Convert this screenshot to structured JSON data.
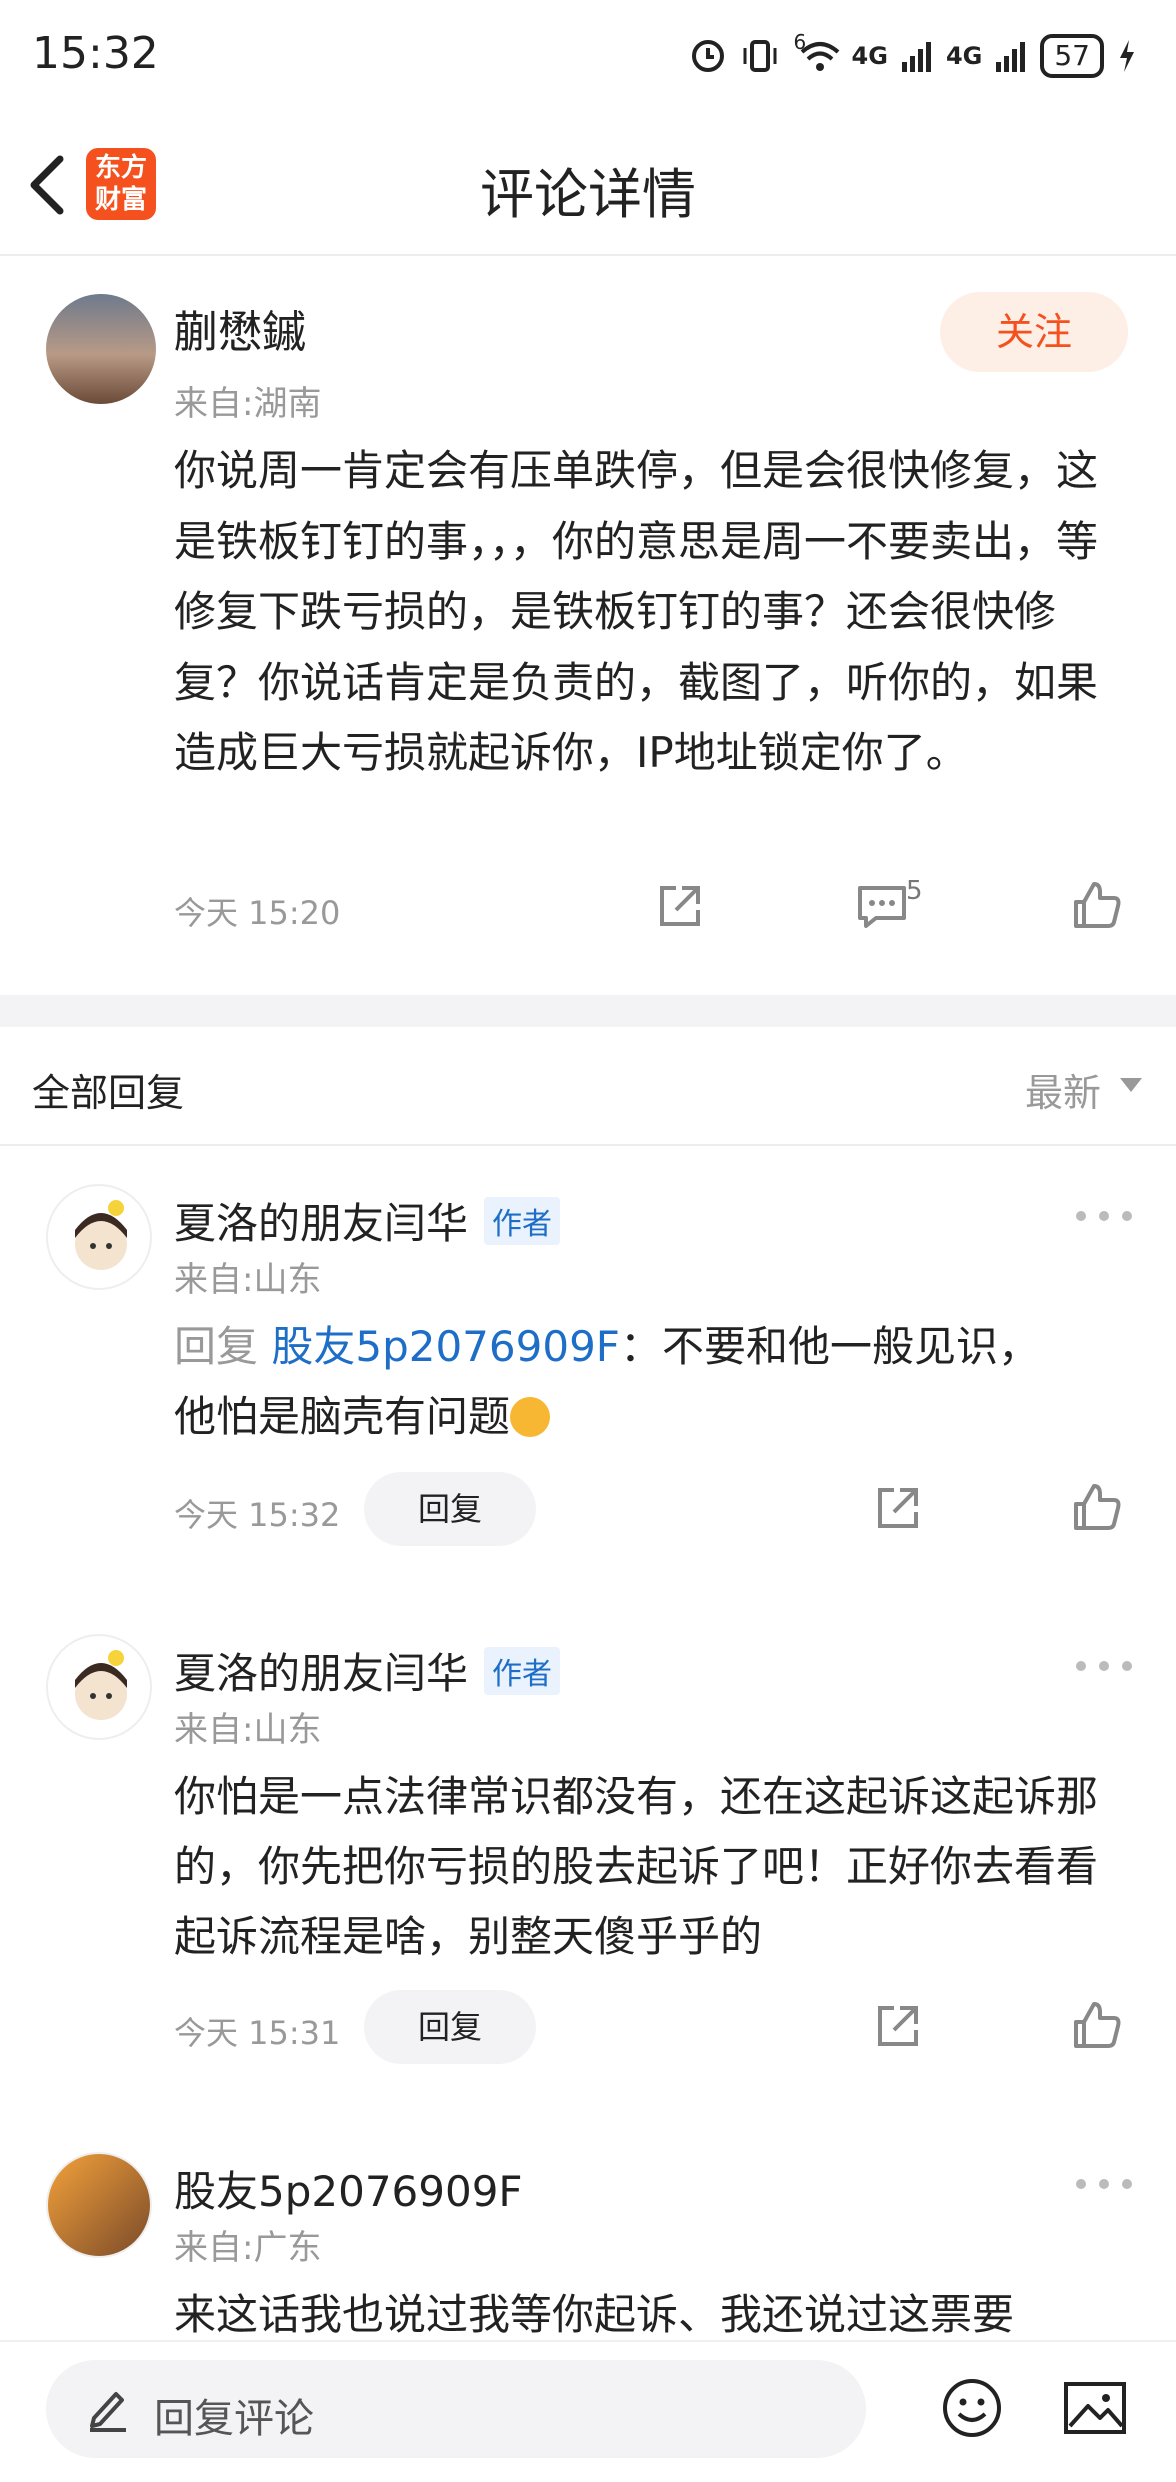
{
  "status_bar": {
    "time": "15:32",
    "network_1": "4G",
    "network_2": "4G",
    "wifi_badge": "6",
    "battery": "57"
  },
  "header": {
    "title": "评论详情",
    "logo_text_1": "东方",
    "logo_text_2": "财富"
  },
  "main_comment": {
    "author": "蒯懋鏚",
    "location": "来自:湖南",
    "follow_label": "关注",
    "text": "你说周一肯定会有压单跌停，但是会很快修复，这是铁板钉钉的事，，，你的意思是周一不要卖出，等修复下跌亏损的，是铁板钉钉的事？还会很快修复？你说话肯定是负责的，截图了，听你的，如果造成巨大亏损就起诉你，IP地址锁定你了。",
    "time": "今天 15:20",
    "reply_count": "5"
  },
  "replies_section": {
    "title": "全部回复",
    "sort_label": "最新"
  },
  "replies": [
    {
      "author": "夏洛的朋友闫华",
      "tag": "作者",
      "location": "来自:山东",
      "reply_prefix": "回复 ",
      "reply_target": "股友5p2076909F",
      "text_line1": "：不要和他一般见识，",
      "text_line2": "他怕是脑壳有问题",
      "time": "今天 15:32",
      "reply_button": "回复"
    },
    {
      "author": "夏洛的朋友闫华",
      "tag": "作者",
      "location": "来自:山东",
      "text": "你怕是一点法律常识都没有，还在这起诉这起诉那的，你先把你亏损的股去起诉了吧！正好你去看看起诉流程是啥，别整天傻乎乎的",
      "time": "今天 15:31",
      "reply_button": "回复"
    },
    {
      "author": "股友5p2076909F",
      "location": "来自:广东",
      "text": "来这话我也说过我等你起诉、我还说过这票要"
    }
  ],
  "bottom_bar": {
    "placeholder": "回复评论"
  },
  "colors": {
    "accent": "#f4511e",
    "link": "#1e6ec8",
    "muted": "#999999"
  },
  "icons": [
    "back-arrow-icon",
    "share-icon",
    "comment-icon",
    "like-icon",
    "more-icon",
    "edit-icon",
    "emoji-icon",
    "image-icon"
  ]
}
